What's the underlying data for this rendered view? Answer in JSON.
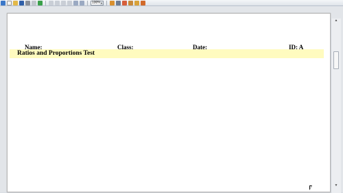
{
  "toolbar": {
    "icons": [
      "edit-icon",
      "new-document-icon",
      "open-folder-icon",
      "save-icon",
      "print-icon",
      "cut-icon",
      "check-icon",
      "undo-icon",
      "redo-icon",
      "copy-icon",
      "paste-icon",
      "table-icon",
      "grid-icon"
    ],
    "zoom": "100%",
    "right_icons": [
      "format-icon",
      "list-icon",
      "palette-icon",
      "brush-icon",
      "gear-icon",
      "help-icon"
    ]
  },
  "document": {
    "name_label": "Name:",
    "class_label": "Class:",
    "date_label": "Date:",
    "id_label": "ID: A",
    "title": "Ratios and Proportions Test"
  },
  "colors": {
    "title_band": "#fffbbf",
    "page": "#ffffff",
    "background": "#e2e5e9"
  }
}
